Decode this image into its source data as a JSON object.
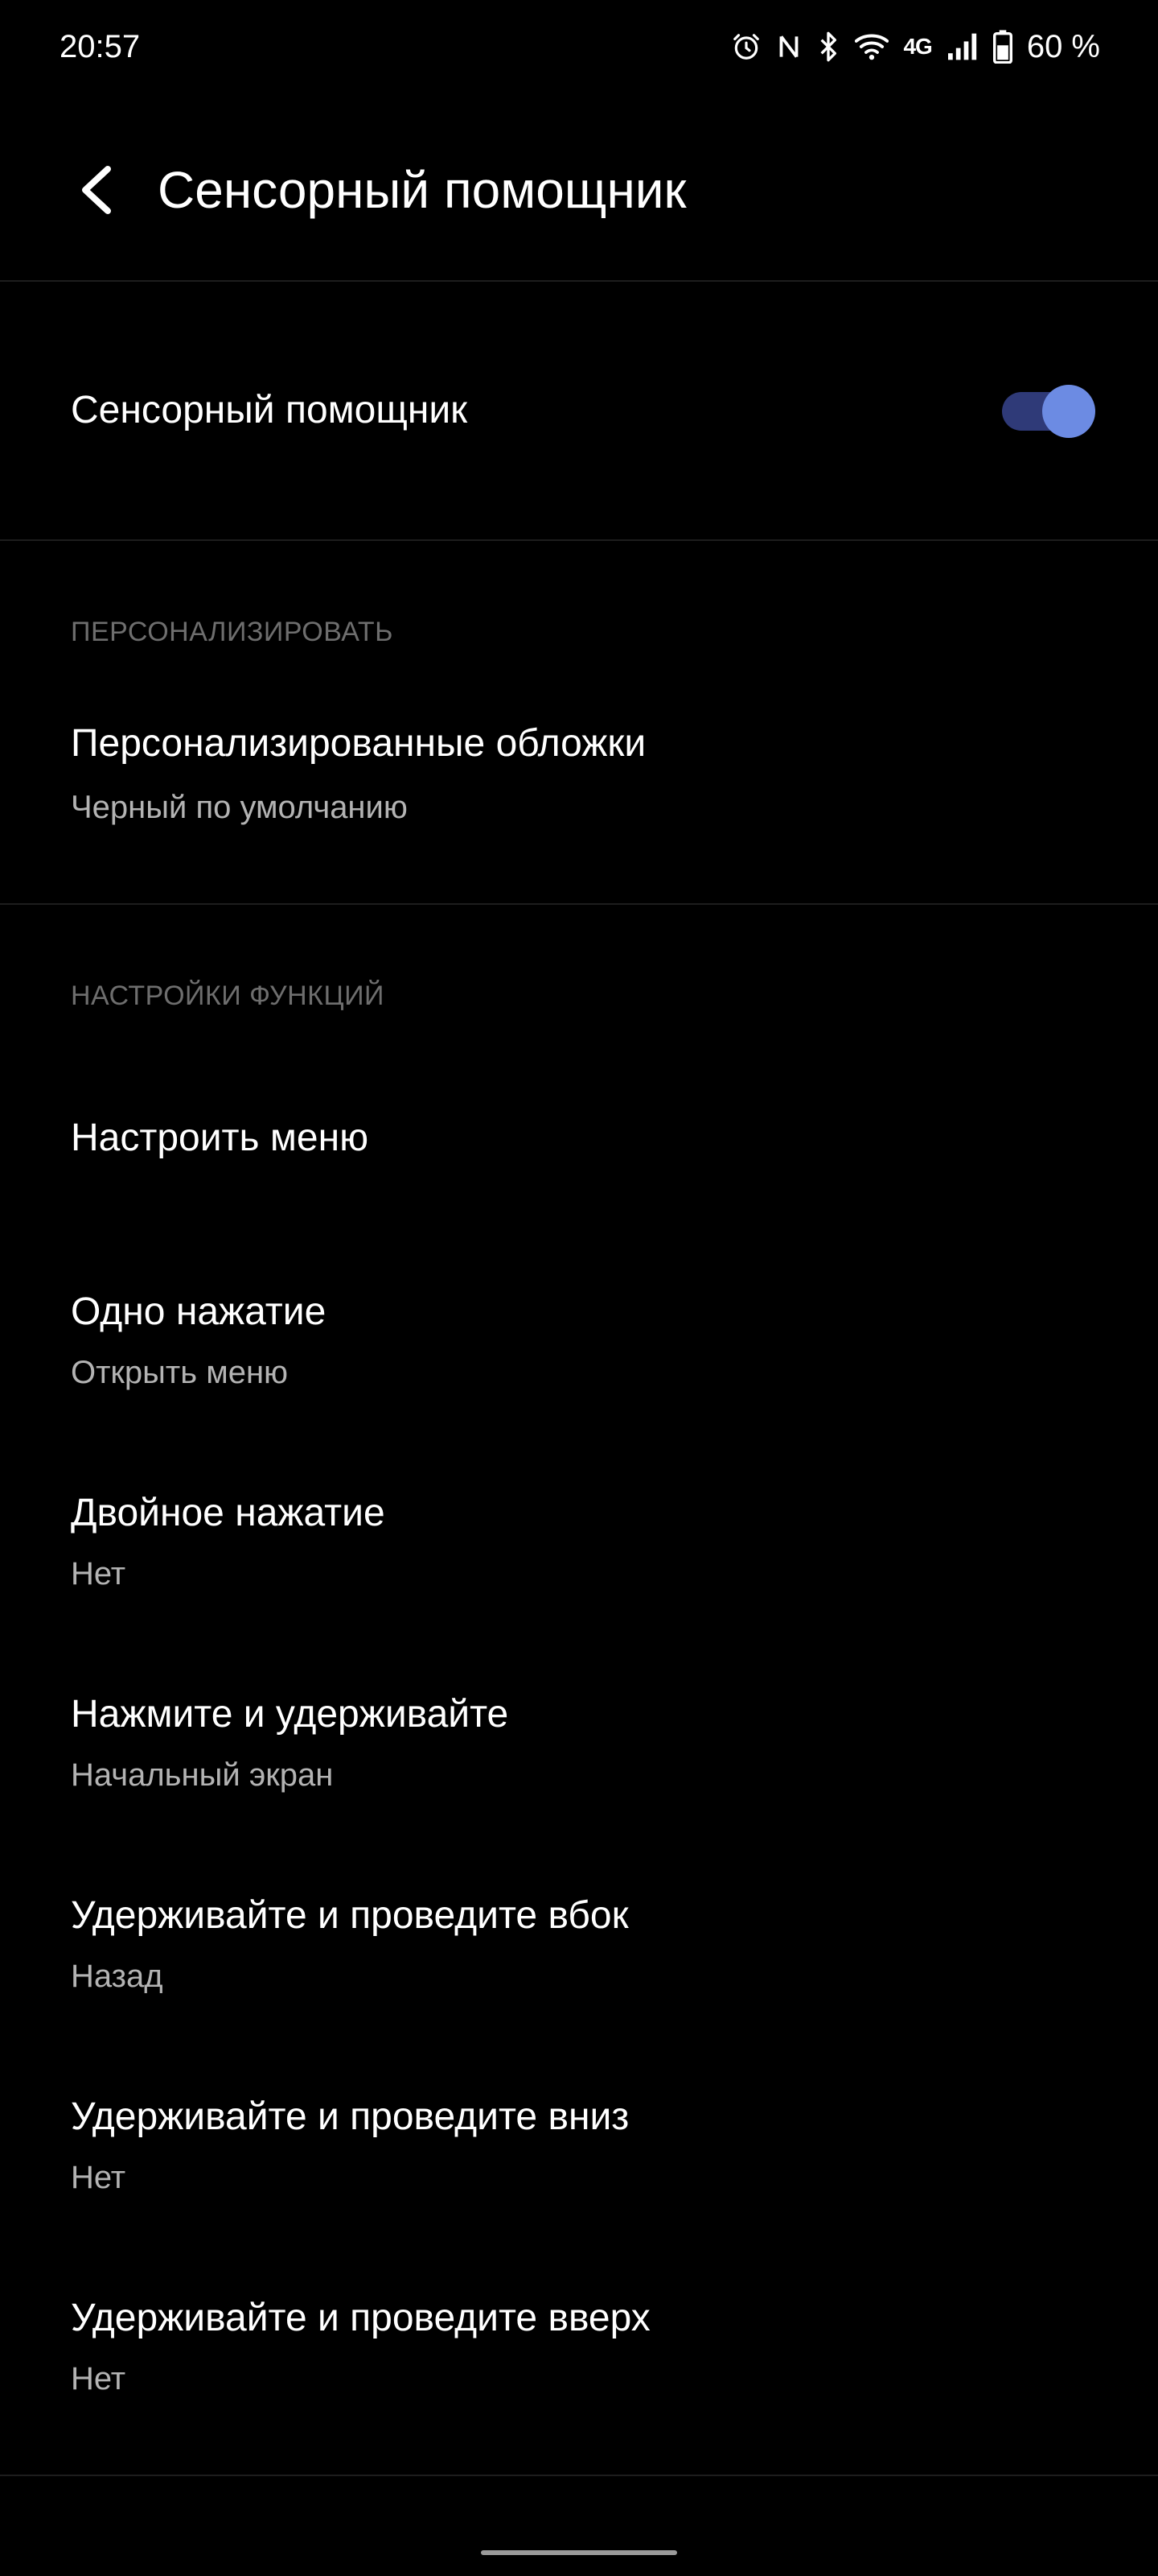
{
  "status_bar": {
    "time": "20:57",
    "network": "4G",
    "battery": "60 %",
    "icons": [
      "alarm-icon",
      "nfc-icon",
      "bluetooth-icon",
      "wifi-icon",
      "signal-icon",
      "battery-icon"
    ]
  },
  "header": {
    "title": "Сенсорный помощник",
    "back_icon": "back-arrow-icon"
  },
  "main_toggle": {
    "label": "Сенсорный помощник",
    "enabled": true,
    "accent_color": "#6c8be3"
  },
  "sections": [
    {
      "header": "ПЕРСОНАЛИЗИРОВАТЬ",
      "items": [
        {
          "title": "Персонализированные обложки",
          "subtitle": "Черный по умолчанию"
        }
      ]
    },
    {
      "header": "НАСТРОЙКИ ФУНКЦИЙ",
      "items": [
        {
          "title": "Настроить меню",
          "subtitle": ""
        },
        {
          "title": "Одно нажатие",
          "subtitle": "Открыть меню"
        },
        {
          "title": "Двойное нажатие",
          "subtitle": "Нет"
        },
        {
          "title": "Нажмите и удерживайте",
          "subtitle": "Начальный экран"
        },
        {
          "title": "Удерживайте и проведите вбок",
          "subtitle": "Назад"
        },
        {
          "title": "Удерживайте и проведите вниз",
          "subtitle": "Нет"
        },
        {
          "title": "Удерживайте и проведите вверх",
          "subtitle": "Нет"
        }
      ]
    }
  ]
}
